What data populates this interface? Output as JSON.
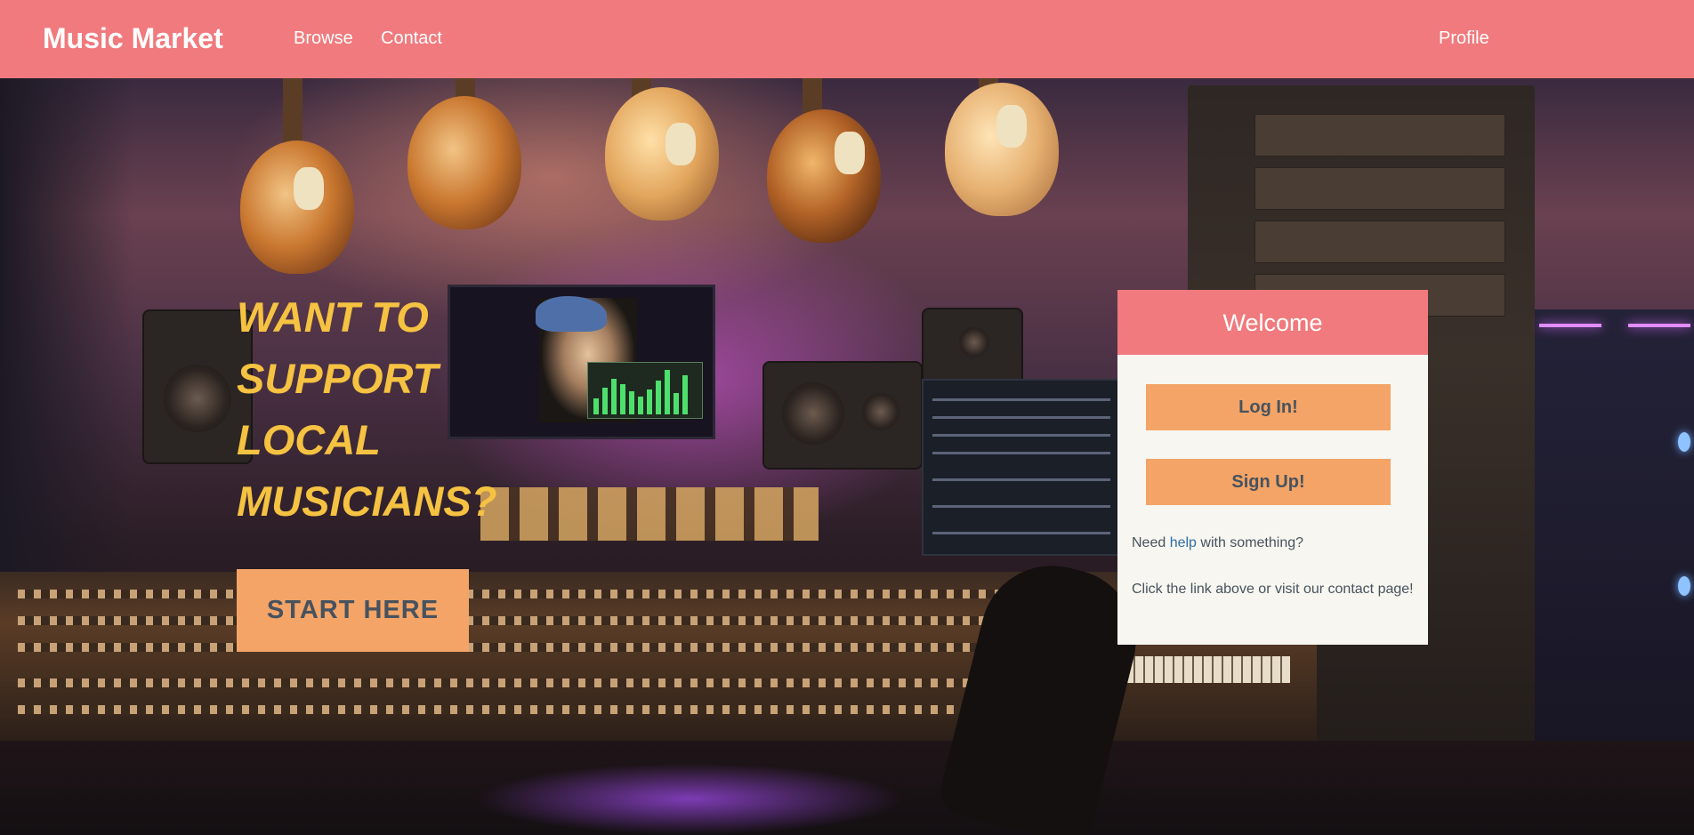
{
  "nav": {
    "brand": "Music Market",
    "links": [
      {
        "label": "Browse"
      },
      {
        "label": "Contact"
      }
    ],
    "profile": "Profile"
  },
  "hero": {
    "headline": [
      "WANT TO",
      "SUPPORT",
      "LOCAL",
      "MUSICIANS?"
    ],
    "cta": "START HERE",
    "background_image": "music-studio-photo"
  },
  "welcome": {
    "title": "Welcome",
    "login_label": "Log In!",
    "signup_label": "Sign Up!",
    "help_prefix": "Need ",
    "help_link": "help",
    "help_suffix": " with something?",
    "contact_text": "Click the link above or visit our contact page!"
  },
  "colors": {
    "nav_bg": "#f07a7d",
    "accent_button": "#f3a466",
    "headline": "#f5c242",
    "card_bg": "#f7f6f0",
    "button_text": "#47525e",
    "link": "#2e6fa5"
  }
}
